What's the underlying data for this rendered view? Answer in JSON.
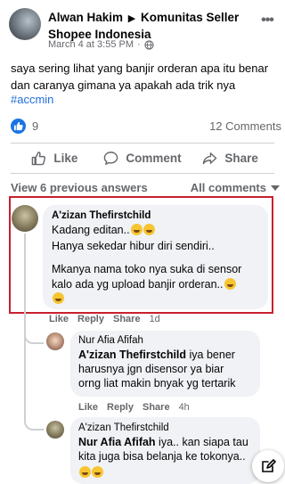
{
  "post": {
    "author": "Alwan Hakim",
    "group": "Komunitas Seller Shopee Indonesia",
    "timestamp": "March 4 at 3:55 PM",
    "body": "saya sering lihat yang banjir orderan apa itu benar dan caranya gimana ya apakah ada trik nya",
    "hashtag": "#accmin",
    "reaction_count": "9",
    "comment_count": "12 Comments"
  },
  "actions": {
    "like": "Like",
    "comment": "Comment",
    "share": "Share"
  },
  "comments_header": {
    "previous": "View 6 previous answers",
    "filter": "All comments"
  },
  "comments": [
    {
      "name": "A'zizan Thefirstchild",
      "line1": "Kadang editan..",
      "line2": "Hanya sekedar hibur diri sendiri..",
      "line3": "Mkanya nama toko nya suka di sensor",
      "line4": "kalo ada yg upload banjir orderan..",
      "like": "Like",
      "reply": "Reply",
      "share": "Share",
      "time": "1d"
    },
    {
      "name": "Nur Afia Afifah",
      "mention": "A'zizan Thefirstchild",
      "line1": " iya bener",
      "line2": "harusnya jgn disensor ya biar",
      "line3": "orng liat makin bnyak yg tertarik",
      "like": "Like",
      "reply": "Reply",
      "share": "Share",
      "time": "4h"
    },
    {
      "name": "A'zizan Thefirstchild",
      "mention": "Nur Afia Afifah",
      "line1": " iya.. kan siapa tau",
      "line2": "kita juga bisa belanja ke tokonya.."
    }
  ],
  "colors": {
    "accent": "#1b74e4",
    "highlight": "#c8202f",
    "bubble": "#f0f2f5",
    "muted": "#65676b"
  }
}
